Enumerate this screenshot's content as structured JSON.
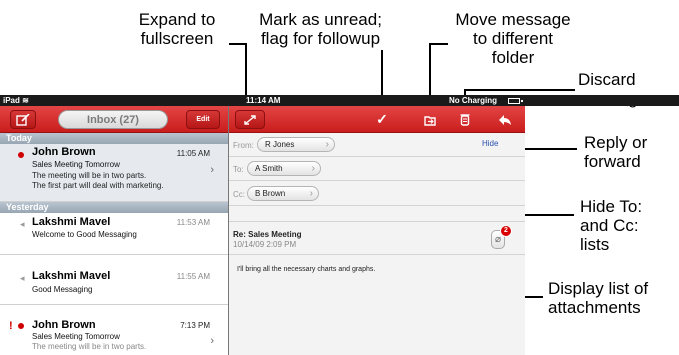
{
  "callouts": {
    "expand": "Expand to\nfullscreen",
    "mark": "Mark as unread;\nflag for followup",
    "move": "Move message\nto different\nfolder",
    "discard": "Discard\nmessage",
    "reply": "Reply or\nforward",
    "hide": "Hide To:\nand Cc:\nlists",
    "attach": "Display list of\nattachments"
  },
  "status_bar": {
    "device": "iPad",
    "time": "11:14 AM",
    "right": "No  Charging"
  },
  "left_toolbar": {
    "compose_icon": "compose-icon",
    "inbox_label": "Inbox (27)",
    "edit_label": "Edit"
  },
  "right_toolbar": {
    "icons": [
      "expand-icon",
      "checkmark-icon",
      "move-folder-icon",
      "trash-icon",
      "reply-icon"
    ]
  },
  "list": {
    "sections": [
      "Today",
      "Yesterday"
    ],
    "messages": [
      {
        "from": "John Brown",
        "time": "11:05 AM",
        "subject": "Sales Meeting Tomorrow",
        "preview1": "The meeting will be in two parts.",
        "preview2": "The first part will deal with marketing.",
        "unread": true
      },
      {
        "from": "Lakshmi Mavel",
        "time": "11:53 AM",
        "subject": "Welcome to Good Messaging"
      },
      {
        "from": "Lakshmi Mavel",
        "time": "11:55 AM",
        "subject": "Good Messaging"
      },
      {
        "from": "John Brown",
        "time": "7:13 PM",
        "subject": "Sales Meeting Tomorrow",
        "preview1": "The meeting will be in two parts.",
        "flag": "!"
      }
    ]
  },
  "message": {
    "from_label": "From:",
    "from": "R Jones",
    "to_label": "To:",
    "to": "A Smith",
    "cc_label": "Cc:",
    "cc": "B Brown",
    "hide_link": "Hide",
    "subject": "Re: Sales Meeting",
    "date": "10/14/09 2:09 PM",
    "body": "I'll bring all the necessary charts and graphs.",
    "attachment_count": "2"
  },
  "colors": {
    "toolbar_red": "#d32f2f",
    "section_header": "#a6b2bd",
    "unread_dot": "#d00000",
    "link_blue": "#2a4fb0"
  }
}
